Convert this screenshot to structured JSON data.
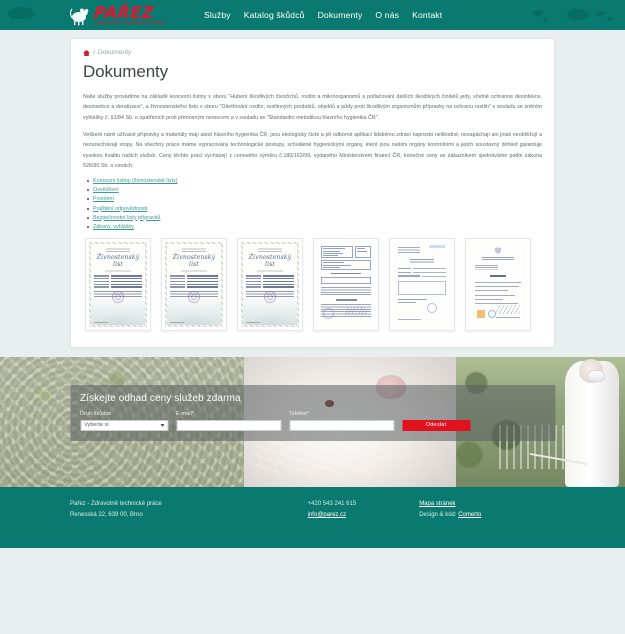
{
  "header": {
    "logo": {
      "word": "PAŘEZ",
      "subtitle": "ZDRAVOTNĚ TECHNICKÉ PRÁCE",
      "mark_icon": "rat-silhouette-icon",
      "color": "#e8112d"
    },
    "nav": [
      {
        "label": "Služby"
      },
      {
        "label": "Katalog škůdců"
      },
      {
        "label": "Dokumenty"
      },
      {
        "label": "O nás"
      },
      {
        "label": "Kontakt"
      }
    ],
    "background_color": "#0a7a70"
  },
  "breadcrumb": {
    "home_icon": "home-icon",
    "separator": "/",
    "current": "Dokumenty"
  },
  "main": {
    "title": "Dokumenty",
    "paragraph_1": "Naše služby provádíme na základě koncesní listiny v oboru \"Hubení škodlivých živočichů, rostlin a mikroorganismů a potlačování dalších škodlivých činitelů jedy, včetně ochranné desinfekce, desinsekce a deratizace\", a živnostenského listu v oboru \"Ošetřování rostlin, rostlinných produktů, objektů a půdy proti škodlivým organismům přípravky na ochranu rostlin\" v souladu se zněním vyhlášky č. 91/84 Sb. o opatřeních proti přenosným nemocem a v souladu se \"Standardní metodikou hlavního hygienika ČR\".",
    "paragraph_2": "Veškeré námi užívané přípravky a materiály mají atest hlavního hygienika ČR, jsou ekologicky čisté a při odborné aplikaci lidskému zdraví naprosto neškodné, nezapáchají ani jinak neobtěžují a nezanechávají stopy. Na všechny práce máme vypracovány technologické postupy, schválené hygienickými orgány, které jsou našimi orgány kontrolními a jejich soustavný dohled garantuje vysokou kvalitu našich služeb. Ceny těchto prací vycházejí z cenového výměru č.180/163/99, vydaného Ministerstvem financí ČR, konečné ceny se zákazníkem sjednáváme podle zákona 526/90 Sb. o cenách.",
    "links": [
      {
        "label": "Koncesní listiny (živnostenské listy)"
      },
      {
        "label": "Osvědčení"
      },
      {
        "label": "Povolení"
      },
      {
        "label": "Pojištění odpovědnosti"
      },
      {
        "label": "Bezpečnostní listy přípravků"
      },
      {
        "label": "Zákony, vyhlášky"
      }
    ],
    "gallery": [
      {
        "type": "certificate",
        "title": "Živnostenský list",
        "alt": "Živnostenský list"
      },
      {
        "type": "certificate",
        "title": "Živnostenský list",
        "alt": "Živnostenský list"
      },
      {
        "type": "certificate",
        "title": "Živnostenský list",
        "alt": "Živnostenský list"
      },
      {
        "type": "form",
        "title": "",
        "alt": "Koncesní listina"
      },
      {
        "type": "letter",
        "title": "",
        "alt": "Osvědčení"
      },
      {
        "type": "official",
        "title": "",
        "alt": "Povolení"
      }
    ]
  },
  "quote": {
    "title": "Získejte odhad ceny služeb zdarma",
    "pest_label": "Druh škůdce",
    "pest_value": "Vyberte si",
    "email_label": "E-mail*",
    "email_value": "",
    "email_placeholder": "",
    "phone_label": "Telefon*",
    "phone_value": "",
    "phone_placeholder": "",
    "submit_label": "Odeslat",
    "submit_color": "#e1111f"
  },
  "footer": {
    "company": "Pařez - Zdravotně technické práce",
    "address": "Renesská 22, 639 00, Brno",
    "phone": "+420 543 241 615",
    "email": "info@parez.cz",
    "sitemap": "Mapa stránek",
    "design_prefix": "Design & kód:",
    "design_author": "Comerto",
    "background_color": "#0a7a70"
  }
}
